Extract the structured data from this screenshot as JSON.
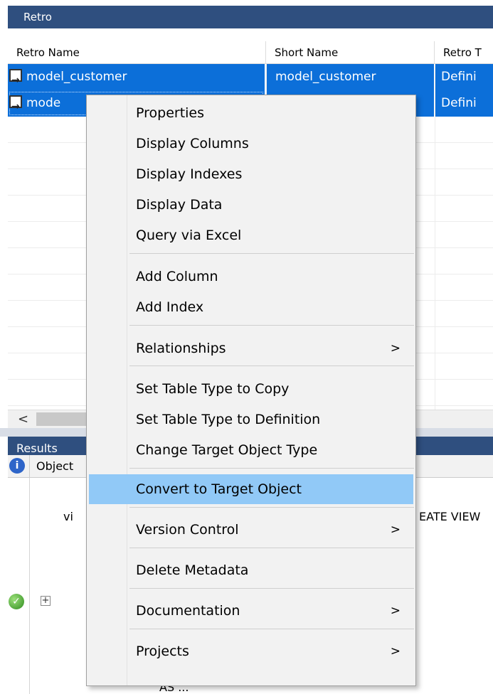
{
  "retro_panel": {
    "title": "Retro",
    "columns": [
      "Retro Name",
      "Short Name",
      "Retro T"
    ],
    "rows": [
      {
        "name": "model_customer",
        "short_name": "model_customer",
        "type": "Defini"
      },
      {
        "name": "mode",
        "short_name": "",
        "type": "Defini"
      }
    ],
    "scroll_left": "<"
  },
  "results_panel": {
    "title": "Results",
    "column": "Object",
    "lines": {
      "vi": "vi",
      "create_view": "EATE VIEW",
      "as": "AS ...\""
    }
  },
  "context_menu": {
    "items": [
      {
        "label": "Properties"
      },
      {
        "label": "Display Columns"
      },
      {
        "label": "Display Indexes"
      },
      {
        "label": "Display Data"
      },
      {
        "label": "Query via Excel"
      },
      {
        "label": "Add Column"
      },
      {
        "label": "Add Index"
      },
      {
        "label": "Relationships",
        "submenu_arrow": ">"
      },
      {
        "label": "Set Table Type to Copy"
      },
      {
        "label": "Set Table Type to Definition"
      },
      {
        "label": "Change Target Object Type"
      },
      {
        "label": "Convert to Target Object"
      },
      {
        "label": "Version Control",
        "submenu_arrow": ">"
      },
      {
        "label": "Delete Metadata"
      },
      {
        "label": "Documentation",
        "submenu_arrow": ">"
      },
      {
        "label": "Projects",
        "submenu_arrow": ">"
      }
    ],
    "highlighted_item": "Convert to Target Object"
  },
  "colors": {
    "panel_title_bg": "#2f4f7f",
    "selection": "#0c6fd9",
    "menu_highlight": "#91c9f7"
  }
}
